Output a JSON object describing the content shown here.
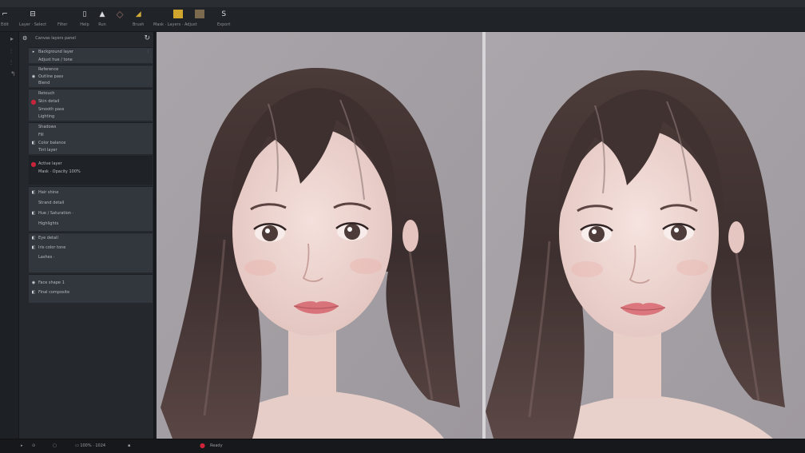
{
  "toolbar": {
    "items": [
      {
        "icon": "⌐",
        "label": "Edit"
      },
      {
        "icon": "⊟",
        "label": "Layer  ·  Select"
      },
      {
        "icon": "▯",
        "label": "Filter"
      },
      {
        "icon": "◍",
        "label": "Help"
      },
      {
        "icon": "⏏",
        "label": "Run"
      },
      {
        "icon": "▲",
        "label": ""
      },
      {
        "icon": "⬦",
        "label": ""
      },
      {
        "icon": "◢",
        "label": "Brush"
      },
      {
        "icon": "✓",
        "label": "Mask  ·  Layers  ·  Adjust"
      },
      {
        "icon": "S",
        "label": "Export"
      }
    ],
    "swatch_colors": [
      "#cfa52d",
      "#7b6a4e"
    ]
  },
  "panel": {
    "title": "Canvas layers panel",
    "groups": [
      {
        "rows": [
          {
            "icon": "▸",
            "text": "Background layer",
            "end": "⫶"
          },
          {
            "icon": "",
            "text": "Adjust hue / tone"
          }
        ]
      },
      {
        "rows": [
          {
            "icon": "",
            "text": "Reference"
          },
          {
            "icon": "◉",
            "text": "Outline pass"
          },
          {
            "icon": "",
            "text": "Blend"
          }
        ]
      },
      {
        "rows": [
          {
            "icon": "",
            "text": "Retouch"
          },
          {
            "icon": "●",
            "text": "Skin detail",
            "red": true
          },
          {
            "icon": "",
            "text": "Smooth pass"
          },
          {
            "icon": "",
            "text": "Lighting"
          }
        ]
      },
      {
        "rows": [
          {
            "icon": "",
            "text": "Shadows"
          },
          {
            "icon": "",
            "text": "Fill"
          },
          {
            "icon": "◧",
            "text": "Color balance"
          },
          {
            "icon": "",
            "text": "Tint layer"
          }
        ]
      },
      {
        "rows": [
          {
            "icon": "●",
            "text": "Active layer",
            "red": true
          },
          {
            "icon": "",
            "text": "Mask  ·  Opacity  100%"
          }
        ],
        "dark": true
      },
      {
        "rows": [
          {
            "icon": "◧",
            "text": "Hair shine"
          },
          {
            "icon": "",
            "text": "Strand detail"
          },
          {
            "icon": "◧",
            "text": "Hue / Saturation  ·"
          },
          {
            "icon": "",
            "text": "Highlights"
          }
        ]
      },
      {
        "rows": [
          {
            "icon": "◧",
            "text": "Eye detail"
          },
          {
            "icon": "◧",
            "text": "Iris color tone"
          },
          {
            "icon": "",
            "text": "Lashes  ·"
          },
          {
            "icon": "",
            "text": ""
          }
        ]
      },
      {
        "rows": [
          {
            "icon": "◉",
            "text": "Face shape   1"
          },
          {
            "icon": "◧",
            "text": "Final composite"
          }
        ]
      }
    ]
  },
  "status": {
    "items": [
      "▸",
      "⊙",
      "▢",
      "▭  100%  ·  1024",
      "▪",
      "●",
      "Ready"
    ]
  }
}
